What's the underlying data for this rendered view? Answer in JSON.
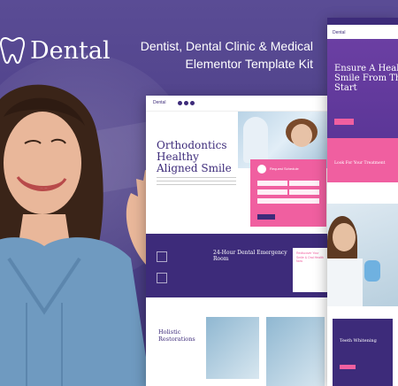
{
  "brand": {
    "name": "Dental"
  },
  "headline": {
    "line1": "Dentist, Dental Clinic & Medical",
    "line2": "Elementor Template Kit"
  },
  "colors": {
    "background": "#4a3f86",
    "purple": "#3d2b7a",
    "pink": "#f05fa0",
    "white": "#ffffff"
  },
  "mockup_main": {
    "hero_title": "Orthodontics Healthy Aligned Smile",
    "form_title": "Request Schedule",
    "band_title": "24-Hour Dental Emergency Room",
    "card_title": "Rediscover Your Smile & Oral Health Now",
    "section_title": "Holistic Restorations"
  },
  "mockup_right": {
    "hero_title": "Ensure A Healthier Smile From The Start",
    "pink_title": "Look For Your Treatment",
    "purple_title": "Teeth Whitening"
  }
}
